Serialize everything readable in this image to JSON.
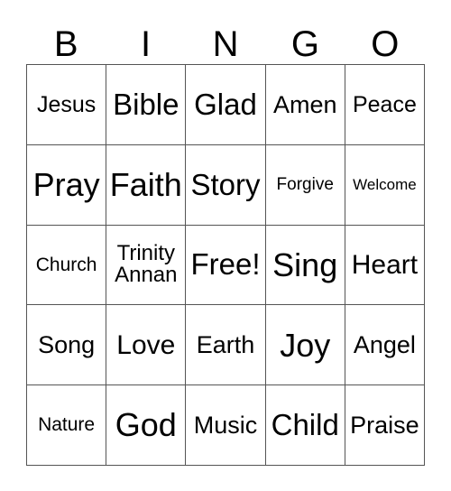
{
  "card": {
    "title_letters": [
      "B",
      "I",
      "N",
      "G",
      "O"
    ],
    "colors": {
      "background": "#ffffff",
      "text": "#000000",
      "grid_line": "#555555"
    },
    "grid": {
      "columns": 5,
      "rows": 5,
      "cells": [
        [
          {
            "text": "Jesus",
            "size": "fs-m"
          },
          {
            "text": "Bible",
            "size": "fs-xl"
          },
          {
            "text": "Glad",
            "size": "fs-xl"
          },
          {
            "text": "Amen",
            "size": "fs-ml"
          },
          {
            "text": "Peace",
            "size": "fs-m"
          }
        ],
        [
          {
            "text": "Pray",
            "size": "fs-xxl"
          },
          {
            "text": "Faith",
            "size": "fs-xxl"
          },
          {
            "text": "Story",
            "size": "fs-xl"
          },
          {
            "text": "Forgive",
            "size": "fs-s"
          },
          {
            "text": "Welcome",
            "size": "fs-xs"
          }
        ],
        [
          {
            "text": "Church",
            "size": "fs-sm"
          },
          {
            "text": "Trinity\nAnnan",
            "size": "fs-two-line"
          },
          {
            "text": "Free!",
            "size": "fs-xl"
          },
          {
            "text": "Sing",
            "size": "fs-xxl"
          },
          {
            "text": "Heart",
            "size": "fs-l"
          }
        ],
        [
          {
            "text": "Song",
            "size": "fs-ml"
          },
          {
            "text": "Love",
            "size": "fs-l"
          },
          {
            "text": "Earth",
            "size": "fs-ml"
          },
          {
            "text": "Joy",
            "size": "fs-xxl"
          },
          {
            "text": "Angel",
            "size": "fs-ml"
          }
        ],
        [
          {
            "text": "Nature",
            "size": "fs-sm"
          },
          {
            "text": "God",
            "size": "fs-xxl"
          },
          {
            "text": "Music",
            "size": "fs-ml"
          },
          {
            "text": "Child",
            "size": "fs-xl"
          },
          {
            "text": "Praise",
            "size": "fs-ml"
          }
        ]
      ]
    }
  }
}
